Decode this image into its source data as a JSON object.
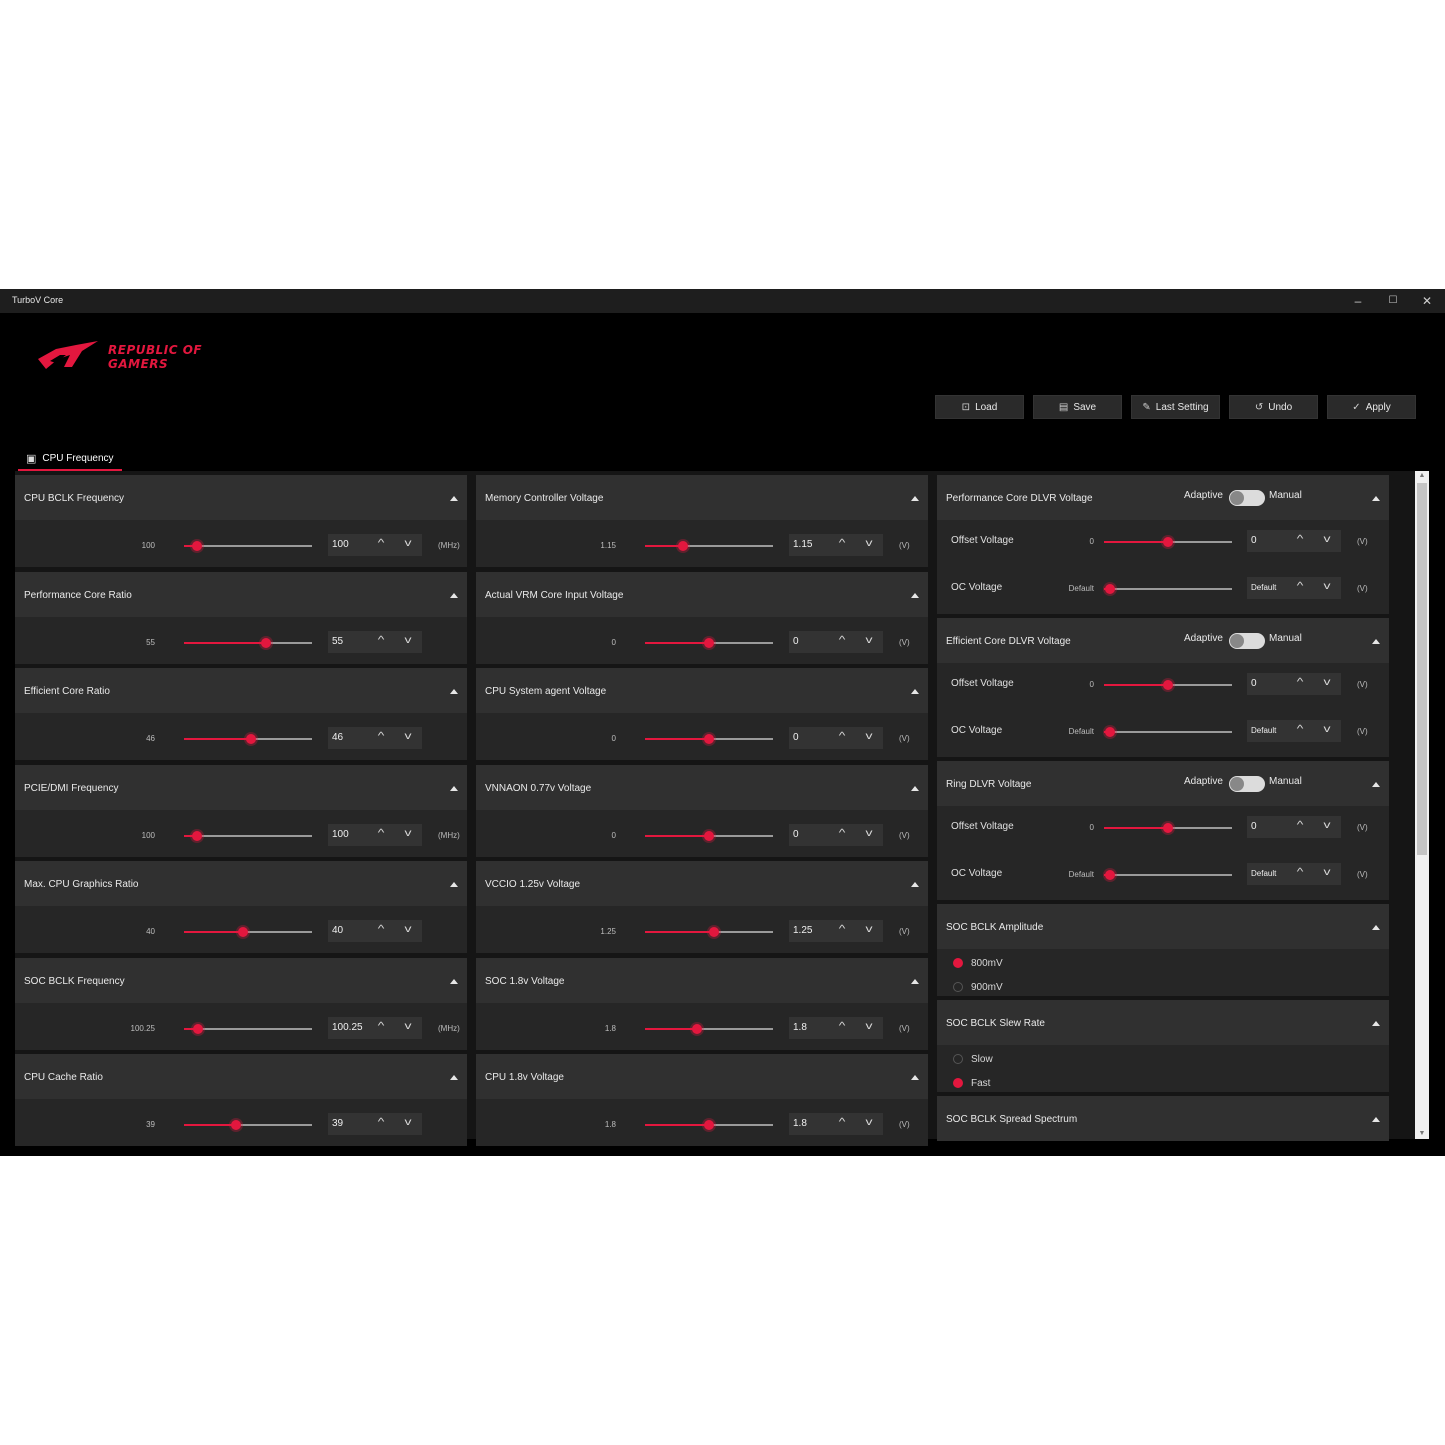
{
  "window": {
    "title": "TurboV Core",
    "controls": {
      "minimize": "–",
      "maximize": "☐",
      "close": "✕"
    }
  },
  "brand": {
    "line1": "REPUBLIC OF",
    "line2": "GAMERS",
    "accent": "#e3173e"
  },
  "toolbar": [
    {
      "label": "Load",
      "icon": "load-icon"
    },
    {
      "label": "Save",
      "icon": "save-icon"
    },
    {
      "label": "Last Setting",
      "icon": "last-setting-icon"
    },
    {
      "label": "Undo",
      "icon": "undo-icon"
    },
    {
      "label": "Apply",
      "icon": "check-icon"
    }
  ],
  "tab": {
    "label": "CPU Frequency",
    "icon": "cpu-icon"
  },
  "left_column": [
    {
      "title": "CPU BCLK Frequency",
      "min": "100",
      "value": "100",
      "unit": "(MHz)",
      "level": 0.1
    },
    {
      "title": "Performance Core Ratio",
      "min": "55",
      "value": "55",
      "unit": "",
      "level": 0.64
    },
    {
      "title": "Efficient Core Ratio",
      "min": "46",
      "value": "46",
      "unit": "",
      "level": 0.52
    },
    {
      "title": "PCIE/DMI Frequency",
      "min": "100",
      "value": "100",
      "unit": "(MHz)",
      "level": 0.1
    },
    {
      "title": "Max. CPU Graphics Ratio",
      "min": "40",
      "value": "40",
      "unit": "",
      "level": 0.46
    },
    {
      "title": "SOC BCLK Frequency",
      "min": "100.25",
      "value": "100.25",
      "unit": "(MHz)",
      "level": 0.11
    },
    {
      "title": "CPU Cache Ratio",
      "min": "39",
      "value": "39",
      "unit": "",
      "level": 0.41
    }
  ],
  "middle_column": [
    {
      "title": "Memory Controller Voltage",
      "min": "1.15",
      "value": "1.15",
      "unit": "(V)",
      "level": 0.3
    },
    {
      "title": "Actual VRM Core Input Voltage",
      "min": "0",
      "value": "0",
      "unit": "(V)",
      "level": 0.5
    },
    {
      "title": "CPU System agent Voltage",
      "min": "0",
      "value": "0",
      "unit": "(V)",
      "level": 0.5
    },
    {
      "title": "VNNAON 0.77v Voltage",
      "min": "0",
      "value": "0",
      "unit": "(V)",
      "level": 0.5
    },
    {
      "title": "VCCIO 1.25v Voltage",
      "min": "1.25",
      "value": "1.25",
      "unit": "(V)",
      "level": 0.54
    },
    {
      "title": "SOC 1.8v Voltage",
      "min": "1.8",
      "value": "1.8",
      "unit": "(V)",
      "level": 0.41
    },
    {
      "title": "CPU 1.8v Voltage",
      "min": "1.8",
      "value": "1.8",
      "unit": "(V)",
      "level": 0.5
    }
  ],
  "right_column": {
    "dlvr": [
      {
        "title": "Performance Core DLVR Voltage",
        "mode_left": "Adaptive",
        "mode_right": "Manual",
        "offset": {
          "label": "Offset Voltage",
          "min": "0",
          "value": "0",
          "unit": "(V)",
          "level": 0.5
        },
        "oc": {
          "label": "OC Voltage",
          "min": "Default",
          "value": "Default",
          "unit": "(V)",
          "level": 0.05
        }
      },
      {
        "title": "Efficient Core DLVR Voltage",
        "mode_left": "Adaptive",
        "mode_right": "Manual",
        "offset": {
          "label": "Offset Voltage",
          "min": "0",
          "value": "0",
          "unit": "(V)",
          "level": 0.5
        },
        "oc": {
          "label": "OC Voltage",
          "min": "Default",
          "value": "Default",
          "unit": "(V)",
          "level": 0.05
        }
      },
      {
        "title": "Ring DLVR Voltage",
        "mode_left": "Adaptive",
        "mode_right": "Manual",
        "offset": {
          "label": "Offset Voltage",
          "min": "0",
          "value": "0",
          "unit": "(V)",
          "level": 0.5
        },
        "oc": {
          "label": "OC Voltage",
          "min": "Default",
          "value": "Default",
          "unit": "(V)",
          "level": 0.05
        }
      }
    ],
    "amplitude": {
      "title": "SOC BCLK Amplitude",
      "options": [
        "800mV",
        "900mV"
      ],
      "selected": "800mV"
    },
    "slew": {
      "title": "SOC BCLK Slew Rate",
      "options": [
        "Slow",
        "Fast"
      ],
      "selected": "Fast"
    },
    "spread": {
      "title": "SOC BCLK Spread Spectrum"
    }
  },
  "stepper_icons": {
    "up": "^",
    "down": "v"
  }
}
